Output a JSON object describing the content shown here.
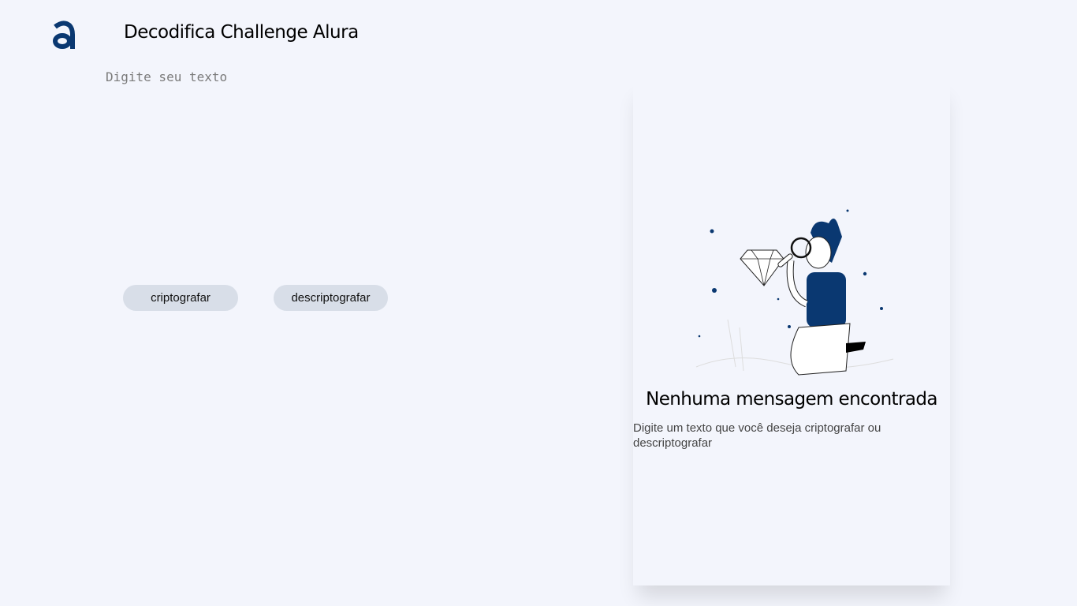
{
  "header": {
    "logo_icon": "alura-logo-icon",
    "title": "Decodifica Challenge Alura"
  },
  "input": {
    "placeholder": "Digite seu texto",
    "value": ""
  },
  "buttons": {
    "encrypt": "criptografar",
    "decrypt": "descriptografar"
  },
  "output": {
    "illustration": "person-with-magnifier-and-diamond",
    "heading": "Nenhuma mensagem encontrada",
    "message": "Digite um texto que você deseja criptografar ou descriptografar"
  },
  "colors": {
    "background": "#f3f5fc",
    "brand": "#0a3871",
    "button": "#d8dee8"
  }
}
